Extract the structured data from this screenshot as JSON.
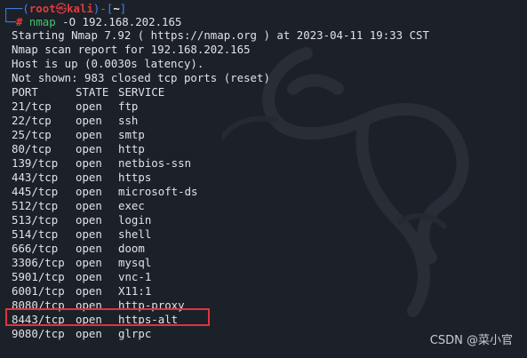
{
  "prompt": {
    "box_top": "┌──(",
    "user": "root",
    "skull": "㉿",
    "host": "kali",
    "mid": ")-[",
    "dir": "~",
    "end": "]",
    "box_bottom": "└─",
    "hash": "#",
    "command": "nmap",
    "args": " -O 192.168.202.165"
  },
  "output_lines": [
    "Starting Nmap 7.92 ( https://nmap.org ) at 2023-04-11 19:33 CST",
    "Nmap scan report for 192.168.202.165",
    "Host is up (0.0030s latency).",
    "Not shown: 983 closed tcp ports (reset)"
  ],
  "table": {
    "headers": [
      "PORT",
      "STATE",
      "SERVICE"
    ],
    "rows": [
      [
        "21/tcp",
        "open",
        "ftp"
      ],
      [
        "22/tcp",
        "open",
        "ssh"
      ],
      [
        "25/tcp",
        "open",
        "smtp"
      ],
      [
        "80/tcp",
        "open",
        "http"
      ],
      [
        "139/tcp",
        "open",
        "netbios-ssn"
      ],
      [
        "443/tcp",
        "open",
        "https"
      ],
      [
        "445/tcp",
        "open",
        "microsoft-ds"
      ],
      [
        "512/tcp",
        "open",
        "exec"
      ],
      [
        "513/tcp",
        "open",
        "login"
      ],
      [
        "514/tcp",
        "open",
        "shell"
      ],
      [
        "666/tcp",
        "open",
        "doom"
      ],
      [
        "3306/tcp",
        "open",
        "mysql"
      ],
      [
        "5901/tcp",
        "open",
        "vnc-1"
      ],
      [
        "6001/tcp",
        "open",
        "X11:1"
      ],
      [
        "8080/tcp",
        "open",
        "http-proxy"
      ],
      [
        "8443/tcp",
        "open",
        "https-alt"
      ],
      [
        "9080/tcp",
        "open",
        "glrpc"
      ]
    ]
  },
  "highlighted_row": 15,
  "watermark": "CSDN @菜小官",
  "colors": {
    "background": "#1c2028",
    "text": "#dfe3e8",
    "prompt_user": "#e23b3b",
    "prompt_box": "#3f86e8",
    "command": "#3fc56a",
    "highlight": "#e0343a"
  }
}
